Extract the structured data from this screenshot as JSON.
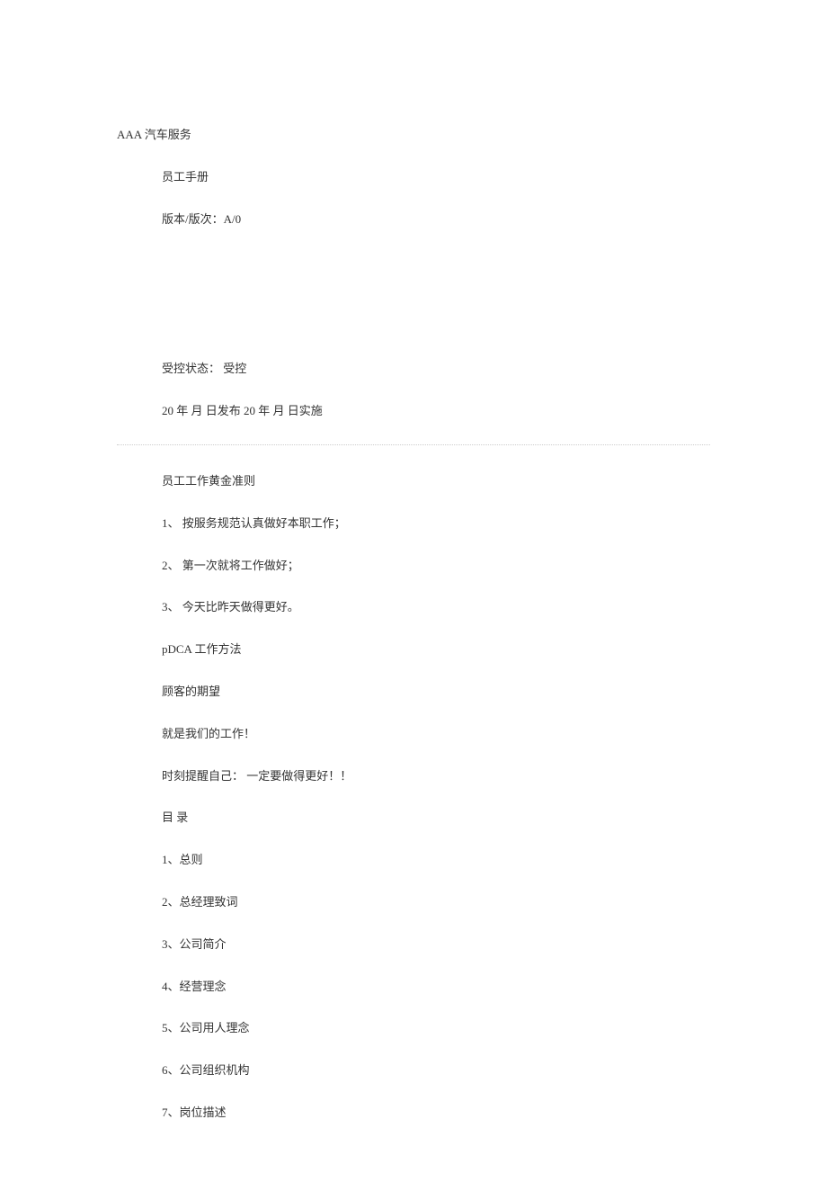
{
  "header": {
    "company": "AAA 汽车服务",
    "title": "员工手册",
    "version": "版本/版次：A/0",
    "control_status": "受控状态：  受控",
    "issue_date": "20 年 月 日发布 20 年 月 日实施"
  },
  "principles": {
    "title": "员工工作黄金准则",
    "items": [
      "1、 按服务规范认真做好本职工作；",
      "2、 第一次就将工作做好；",
      "3、 今天比昨天做得更好。"
    ]
  },
  "pdca": {
    "title": "pDCA 工作方法",
    "line1": "顾客的期望",
    "line2": "就是我们的工作！",
    "reminder": "时刻提醒自己： 一定要做得更好！！"
  },
  "toc": {
    "title": "目 录",
    "items": [
      "1、总则",
      "2、总经理致词",
      "3、公司简介",
      "4、经营理念",
      "5、公司用人理念",
      "6、公司组织机构",
      "7、岗位描述"
    ]
  }
}
